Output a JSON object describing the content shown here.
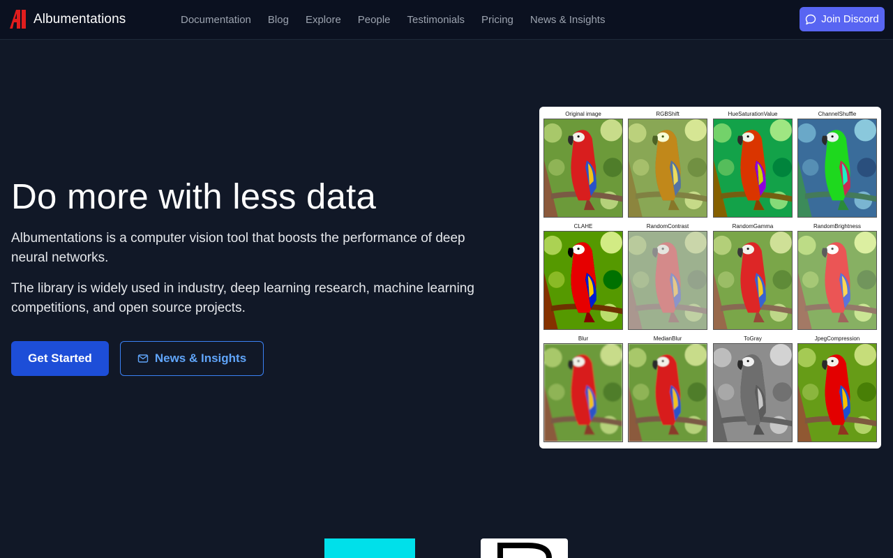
{
  "brand": {
    "name": "Albumentations"
  },
  "nav": {
    "links": [
      "Documentation",
      "Blog",
      "Explore",
      "People",
      "Testimonials",
      "Pricing",
      "News & Insights"
    ],
    "discord_label": "Join Discord"
  },
  "hero": {
    "title": "Do more with less data",
    "paragraph_1": "Albumentations is a computer vision tool that boosts the performance of deep neural networks.",
    "paragraph_2": "The library is widely used in industry, deep learning research, machine learning competitions, and open source projects.",
    "primary_button": "Get Started",
    "secondary_button": "News & Insights"
  },
  "augmentations": [
    {
      "label": "Original image",
      "filter": "none"
    },
    {
      "label": "RGBShift",
      "filter": "rgbshift"
    },
    {
      "label": "HueSaturationValue",
      "filter": "hsv"
    },
    {
      "label": "ChannelShuffle",
      "filter": "channelshuffle"
    },
    {
      "label": "CLAHE",
      "filter": "clahe"
    },
    {
      "label": "RandomContrast",
      "filter": "contrast"
    },
    {
      "label": "RandomGamma",
      "filter": "gamma"
    },
    {
      "label": "RandomBrightness",
      "filter": "brightness"
    },
    {
      "label": "Blur",
      "filter": "blur"
    },
    {
      "label": "MedianBlur",
      "filter": "medianblur"
    },
    {
      "label": "ToGray",
      "filter": "gray"
    },
    {
      "label": "JpegCompression",
      "filter": "jpeg"
    }
  ],
  "colors": {
    "background": "#111827",
    "nav_background": "#0b1120",
    "primary_button": "#1d4ed8",
    "discord": "#5865f2",
    "outline_accent": "#60a5fa",
    "logo_red": "#e11d1d"
  }
}
